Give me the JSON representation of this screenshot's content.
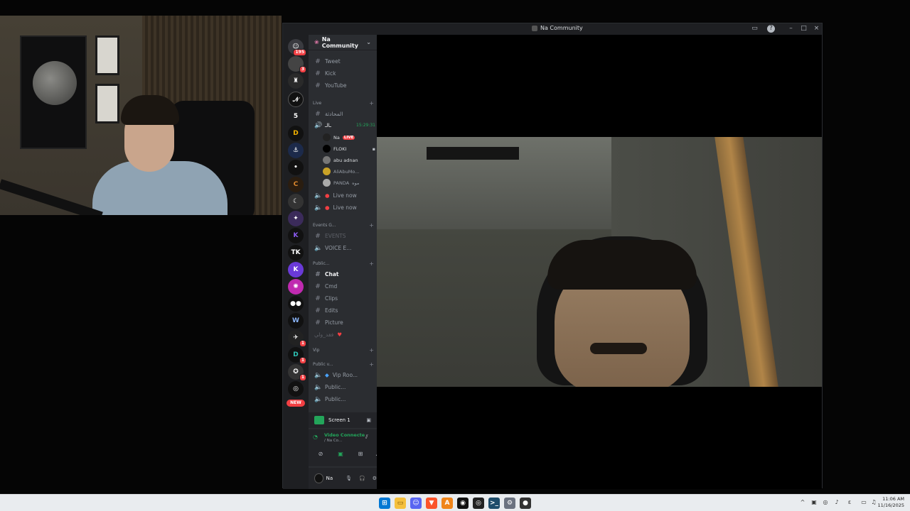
{
  "window": {
    "title": "Na Community"
  },
  "server": {
    "name": "Na Community"
  },
  "guilds": [
    {
      "badge": "195"
    },
    {
      "badge": "3"
    },
    {
      "badge": ""
    },
    {
      "badge": ""
    },
    {
      "label": "5"
    },
    {
      "badge": ""
    },
    {
      "badge": ""
    },
    {
      "badge": ""
    },
    {
      "badge": ""
    },
    {
      "badge": ""
    },
    {
      "badge": ""
    },
    {
      "badge": ""
    },
    {
      "badge": ""
    },
    {
      "badge": ""
    },
    {
      "badge": ""
    },
    {
      "badge": ""
    },
    {
      "badge": ""
    },
    {
      "badge": "1"
    },
    {
      "badge": "1"
    },
    {
      "badge": "1"
    },
    {
      "badge": "NEW"
    }
  ],
  "channels": {
    "text_top": [
      {
        "name": "Tweet"
      },
      {
        "name": "Kick"
      },
      {
        "name": "YouTube"
      }
    ],
    "cat_live": "Live",
    "ar_channel": "المحادثة",
    "live_voice": {
      "name": "ـالـ",
      "timer": "15:29:31"
    },
    "voice_users": [
      {
        "name": "Na",
        "live": "LIVE"
      },
      {
        "name": "FLOKI"
      },
      {
        "name": "abu adnan"
      },
      {
        "name": "AliAbuMo..."
      },
      {
        "name": "PANDA",
        "extra": "موه"
      }
    ],
    "live_now": [
      "Live now",
      "Live now"
    ],
    "cat_events": "Events G...",
    "events": "EVENTS",
    "voice_events": "VOICE E...",
    "cat_public": "Public...",
    "public": [
      "Chat",
      "Cmd",
      "Clips",
      "Edits",
      "Picture"
    ],
    "ar_channel2": "فقد_ولي",
    "cat_vip": "Vip",
    "cat_public_v": "Public v...",
    "vip_voice": [
      "Vip Roo...",
      "Public...",
      "Public..."
    ]
  },
  "panels": {
    "stream_label": "Screen 1",
    "voice_status": "Video Connecte",
    "voice_sub": "/ Na Co...",
    "user_name": "Na"
  },
  "taskbar": {
    "time": "11:06 AM",
    "date": "11/16/2025"
  },
  "colors": {
    "accent": "#5865f2",
    "live": "#f23f43",
    "connected": "#23a55a"
  }
}
